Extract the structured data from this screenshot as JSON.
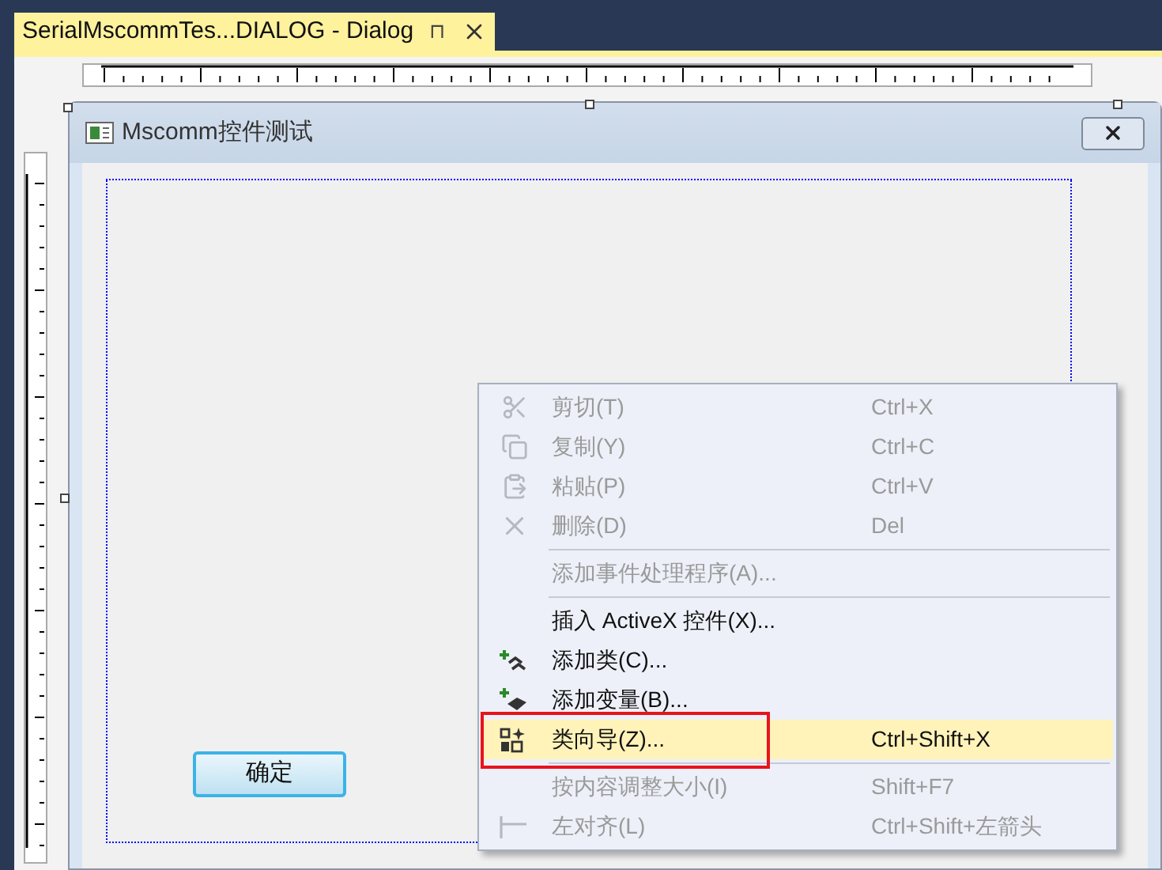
{
  "tab": {
    "title": "SerialMscommTes...DIALOG - Dialog",
    "pin": "⊓"
  },
  "dialog": {
    "title": "Mscomm控件测试",
    "ok_button": "确定"
  },
  "context_menu": {
    "groups": [
      [
        {
          "kind": "scissors",
          "label": "剪切(T)",
          "shortcut": "Ctrl+X",
          "disabled": true,
          "selected": false,
          "annotated": false
        },
        {
          "kind": "copy",
          "label": "复制(Y)",
          "shortcut": "Ctrl+C",
          "disabled": true,
          "selected": false,
          "annotated": false
        },
        {
          "kind": "paste",
          "label": "粘贴(P)",
          "shortcut": "Ctrl+V",
          "disabled": true,
          "selected": false,
          "annotated": false
        },
        {
          "kind": "delete",
          "label": "删除(D)",
          "shortcut": "Del",
          "disabled": true,
          "selected": false,
          "annotated": false
        }
      ],
      [
        {
          "kind": "plain",
          "label": "添加事件处理程序(A)...",
          "disabled": true,
          "selected": false,
          "annotated": false
        }
      ],
      [
        {
          "kind": "plain",
          "label": "插入 ActiveX 控件(X)...",
          "disabled": false,
          "selected": false,
          "annotated": false
        },
        {
          "kind": "add-class",
          "label": "添加类(C)...",
          "disabled": false,
          "selected": false,
          "annotated": false
        },
        {
          "kind": "add-variable",
          "label": "添加变量(B)...",
          "disabled": false,
          "selected": false,
          "annotated": false
        },
        {
          "kind": "wizard",
          "label": "类向导(Z)...",
          "shortcut": "Ctrl+Shift+X",
          "disabled": false,
          "selected": true,
          "annotated": true
        }
      ],
      [
        {
          "kind": "plain",
          "label": "按内容调整大小(I)",
          "shortcut": "Shift+F7",
          "disabled": true,
          "selected": false,
          "annotated": false
        },
        {
          "kind": "align-left",
          "label": "左对齐(L)",
          "shortcut": "Ctrl+Shift+左箭头",
          "disabled": true,
          "selected": false,
          "annotated": false
        }
      ]
    ]
  }
}
